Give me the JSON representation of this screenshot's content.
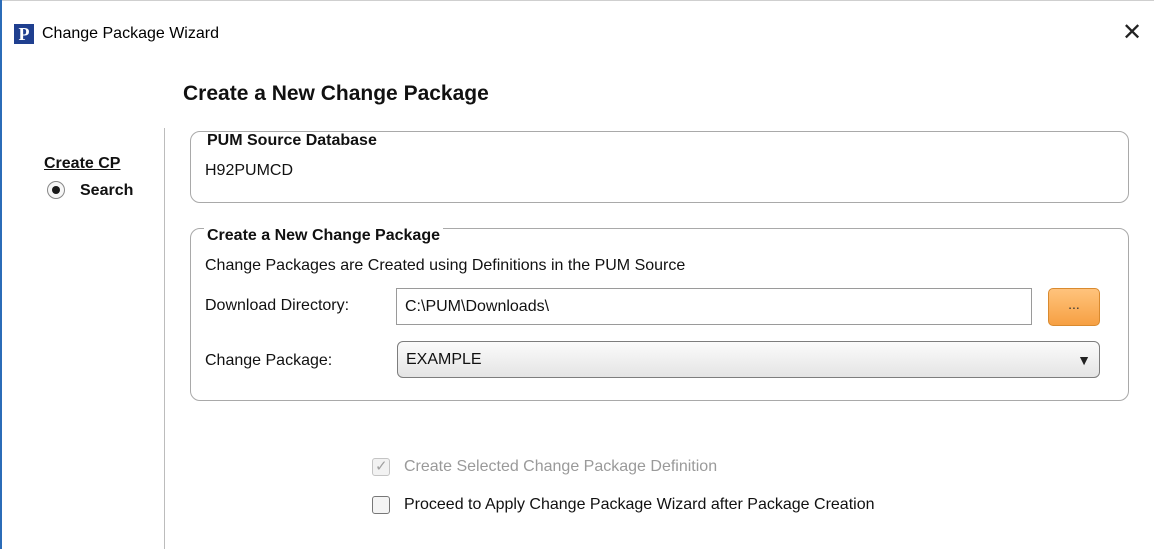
{
  "window": {
    "icon_letter": "P",
    "title": "Change Package Wizard",
    "close_glyph": "✕"
  },
  "page": {
    "title": "Create a New Change Package"
  },
  "nav": {
    "section_title": "Create CP",
    "items": [
      {
        "label": "Search",
        "selected": true
      }
    ]
  },
  "source_group": {
    "legend": "PUM Source Database",
    "value": "H92PUMCD"
  },
  "package_group": {
    "legend": "Create a New Change Package",
    "description": "Change Packages are Created using Definitions in the PUM Source",
    "download_dir": {
      "label": "Download Directory:",
      "value": "C:\\PUM\\Downloads\\"
    },
    "browse_label": "...",
    "change_package": {
      "label": "Change Package:",
      "selected": "EXAMPLE",
      "arrow": "▼"
    }
  },
  "options": [
    {
      "label": "Create Selected Change Package Definition",
      "checked": true,
      "disabled": true
    },
    {
      "label": "Proceed to Apply Change Package Wizard after Package Creation",
      "checked": false,
      "disabled": false
    }
  ],
  "colors": {
    "browse_button": "#f6a043",
    "accent_border": "#2b6cb8",
    "disabled_text": "#9a9a9a"
  }
}
